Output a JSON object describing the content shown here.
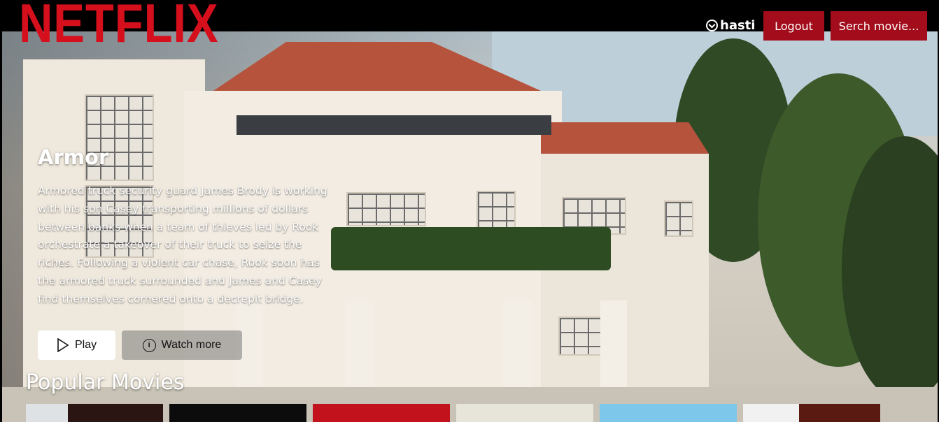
{
  "header": {
    "logo": "NETFLIX",
    "username": "hasti",
    "logout_label": "Logout",
    "search_label": "Serch movie..."
  },
  "featured": {
    "title": "Armor",
    "overview": "Armored truck security guard James Brody is working with his son Casey transporting millions of dollars between banks when a team of thieves led by Rook orchestrate a takeover of their truck to seize the riches. Following a violent car chase, Rook soon has the armored truck surrounded and James and Casey find themselves cornered onto a decrepit bridge.",
    "play_label": "Play",
    "more_label": "Watch more",
    "play_icon": "play-icon",
    "info_icon": "info-icon"
  },
  "popular": {
    "title": "Popular Movies",
    "posters": [
      {
        "color": "#2a1512"
      },
      {
        "color": "#0c0c0c"
      },
      {
        "color": "#c2121b"
      },
      {
        "color": "#e7e4da"
      },
      {
        "color": "#7cc7ea"
      },
      {
        "color": "#5a1a12"
      }
    ]
  },
  "colors": {
    "brand": "#d50f1c",
    "button_red": "#a30d1b"
  }
}
